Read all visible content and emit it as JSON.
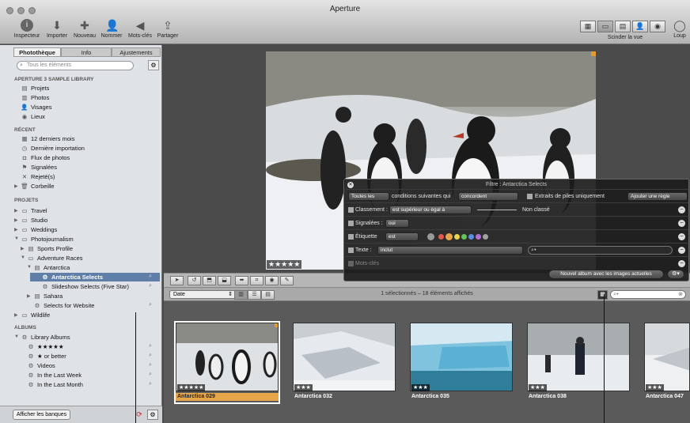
{
  "app": {
    "title": "Aperture"
  },
  "toolbar": {
    "items": [
      {
        "label": "Inspecteur",
        "icon": "info-icon"
      },
      {
        "label": "Importer",
        "icon": "import-icon"
      },
      {
        "label": "Nouveau",
        "icon": "plus-icon"
      },
      {
        "label": "Nommer",
        "icon": "person-icon"
      },
      {
        "label": "Mots-clés",
        "icon": "tag-icon"
      },
      {
        "label": "Partager",
        "icon": "share-icon"
      }
    ],
    "split_view": "Scinder la vue",
    "loupe": "Loup"
  },
  "sidebar": {
    "tabs": [
      "Photothèque",
      "Info",
      "Ajustements"
    ],
    "search_placeholder": "Tous les éléments",
    "sections": {
      "library": "APERTURE 3 SAMPLE LIBRARY",
      "recent": "RÉCENT",
      "projects": "PROJETS",
      "albums": "ALBUMS"
    },
    "library_items": [
      "Projets",
      "Photos",
      "Visages",
      "Lieux"
    ],
    "recent_items": [
      "12 derniers mois",
      "Dernière importation",
      "Flux de photos",
      "Signalées",
      "Rejeté(s)",
      "Corbeille"
    ],
    "projects_items": [
      "Travel",
      "Studio",
      "Weddings",
      "Photojournalism",
      "Sports Profile",
      "Adventure Races",
      "Antarctica",
      "Antarctica Selects",
      "Slideshow Selects (Five Star)",
      "Sahara",
      "Selects for Website",
      "Wildlife"
    ],
    "albums_items": [
      "Library Albums",
      "★★★★★",
      "★ or better",
      "Videos",
      "In the Last Week",
      "In the Last Month"
    ],
    "show_vaults": "Afficher les banques"
  },
  "viewer": {
    "rating": "★★★★★"
  },
  "filter_hud": {
    "title": "Filtre : Antarctica Selects",
    "match_scope": "Toutes les",
    "conditions_text": "conditions suivantes qui",
    "match_mode": "concordent",
    "stacks_only": "Extraits de piles uniquement",
    "add_rule": "Ajouter une règle",
    "rows": [
      {
        "label": "Classement :",
        "op": "est supérieur ou égal à",
        "value": "Non classé"
      },
      {
        "label": "Signalées :",
        "op": "oui"
      },
      {
        "label": "Étiquette",
        "op": "est"
      },
      {
        "label": "Texte :",
        "op": "inclut"
      },
      {
        "label": "Mots-clés"
      }
    ],
    "new_album": "Nouvel album avec les images actuelles"
  },
  "browser": {
    "sort": "Date",
    "status": "1 sélectionnés – 18 éléments affichés",
    "thumbs": [
      {
        "name": "Antarctica 029",
        "rating": "★★★★★"
      },
      {
        "name": "Antarctica 032",
        "rating": "★★★"
      },
      {
        "name": "Antarctica 035",
        "rating": "★★★"
      },
      {
        "name": "Antarctica 038",
        "rating": "★★★"
      },
      {
        "name": "Antarctica 047",
        "rating": "★★★"
      }
    ]
  },
  "colors": {
    "selection": "#5f7ea8",
    "label_orange": "#e8a64a"
  }
}
